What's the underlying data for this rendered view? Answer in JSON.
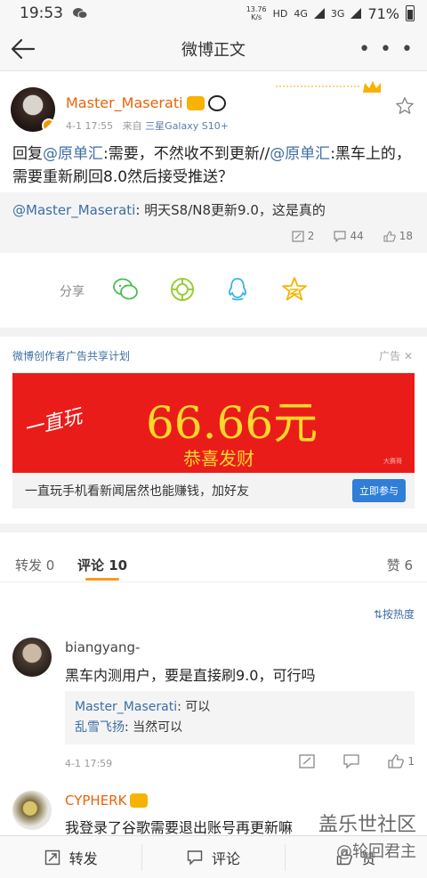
{
  "status": {
    "time": "19:53",
    "speed_top": "13.76",
    "speed_unit": "K/s",
    "hd": "HD",
    "net1": "4G",
    "net2": "3G",
    "battery": "71%"
  },
  "nav": {
    "title": "微博正文"
  },
  "post": {
    "username": "Master_Maserati",
    "date": "4-1 17:55",
    "source_prefix": "来自",
    "source_device": "三星Galaxy S10+",
    "text": [
      {
        "t": "回复",
        "at": false
      },
      {
        "t": "@原单汇",
        "at": true
      },
      {
        "t": ":需要，不然收不到更新//",
        "at": false
      },
      {
        "t": "@原单汇",
        "at": true
      },
      {
        "t": ":黑车上的，需要重新刷回8.0然后接受推送？",
        "at": false
      }
    ],
    "repost_user": "@Master_Maserati",
    "repost_text": ": 明天S8/N8更新9.0，这是真的",
    "reposts": "2",
    "comments": "44",
    "likes": "18"
  },
  "share": {
    "label": "分享"
  },
  "ad": {
    "title": "微博创作者广告共享计划",
    "tag": "广告",
    "banner_left": "一直玩",
    "banner_amount": "66.66元",
    "banner_wish": "恭喜发财",
    "banner_mini": "大赛哥",
    "desc": "一直玩手机看新闻居然也能赚钱，加好友",
    "button": "立即参与"
  },
  "tabs": {
    "repost": "转发 0",
    "comment_label": "评论",
    "comment_count": "10",
    "like": "赞 6",
    "sort": "按热度"
  },
  "comment1": {
    "name": "biangyang-",
    "text": "黑车内测用户，要是直接刷9.0，可行吗",
    "reply1_user": "Master_Maserati",
    "reply1_text": ": 可以",
    "reply2_user": "乱雪飞扬",
    "reply2_text": ": 当然可以",
    "time": "4-1 17:59",
    "likes": "1"
  },
  "comment2": {
    "name": "CYPHERK",
    "text": "我登录了谷歌需要退出账号再更新嘛"
  },
  "bottom": {
    "repost": "转发",
    "comment": "评论",
    "like": "赞"
  },
  "watermark": {
    "line1": "盖乐世社区",
    "line2": "@轮回君主"
  },
  "colors": {
    "link": "#3e6ea1",
    "username": "#e8630a",
    "banner": "#ea1c1a",
    "accent": "#f49c1a"
  }
}
